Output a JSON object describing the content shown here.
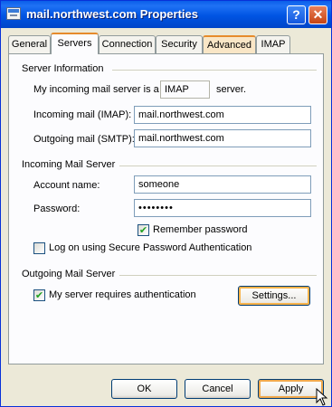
{
  "window": {
    "title": "mail.northwest.com Properties"
  },
  "tabs": [
    {
      "label": "General"
    },
    {
      "label": "Servers"
    },
    {
      "label": "Connection"
    },
    {
      "label": "Security"
    },
    {
      "label": "Advanced"
    },
    {
      "label": "IMAP"
    }
  ],
  "active_tab": "Servers",
  "server_info": {
    "heading": "Server Information",
    "incoming_prefix": "My incoming mail server is a",
    "incoming_type": "IMAP",
    "incoming_suffix": "server.",
    "incoming_label": "Incoming mail (IMAP):",
    "incoming_value": "mail.northwest.com",
    "outgoing_label": "Outgoing mail (SMTP):",
    "outgoing_value": "mail.northwest.com"
  },
  "incoming_server": {
    "heading": "Incoming Mail Server",
    "account_label": "Account name:",
    "account_value": "someone",
    "password_label": "Password:",
    "password_value": "••••••••",
    "remember_label": "Remember password",
    "remember_checked": true,
    "spa_label": "Log on using Secure Password Authentication",
    "spa_checked": false
  },
  "outgoing_server": {
    "heading": "Outgoing Mail Server",
    "auth_label": "My server requires authentication",
    "auth_checked": true,
    "settings_button": "Settings..."
  },
  "footer": {
    "ok": "OK",
    "cancel": "Cancel",
    "apply": "Apply"
  },
  "icons": [
    "window-icon",
    "help-icon",
    "close-icon",
    "mouse-cursor-icon"
  ]
}
